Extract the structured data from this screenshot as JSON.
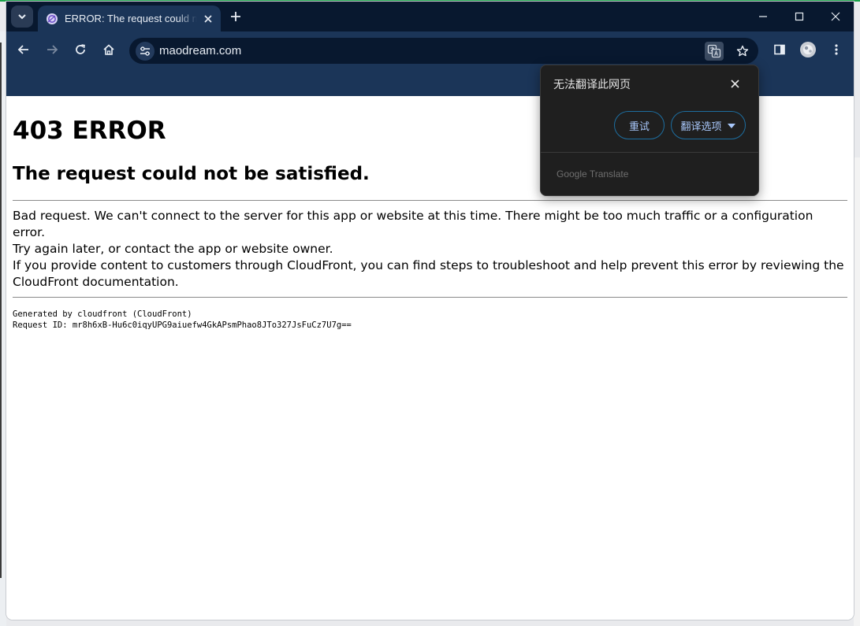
{
  "browser": {
    "tab": {
      "title": "ERROR: The request could not be satisfied"
    },
    "address": {
      "url": "maodream.com"
    }
  },
  "page": {
    "heading": "403 ERROR",
    "subheading": "The request could not be satisfied.",
    "body_lines": [
      "Bad request. We can't connect to the server for this app or website at this time. There might be too much traffic or a configuration error.",
      "Try again later, or contact the app or website owner.",
      "If you provide content to customers through CloudFront, you can find steps to troubleshoot and help prevent this error by reviewing the",
      "CloudFront documentation."
    ],
    "generated_by": "Generated by cloudfront (CloudFront)",
    "request_id": "Request ID: mr8h6xB-Hu6c0iqyUPG9aiuefw4GkAPsmPhao8JTo327JsFuCz7U7g=="
  },
  "translate_popup": {
    "title": "无法翻译此网页",
    "retry_label": "重试",
    "options_label": "翻译选项",
    "footer": "Google Translate"
  },
  "icons": {
    "tab_search": "chevron-down-icon",
    "favicon": "globe-icon",
    "tab_close": "close-icon",
    "new_tab": "plus-icon",
    "minimize": "minimize-icon",
    "maximize": "maximize-icon",
    "close_window": "close-icon",
    "back": "arrow-left-icon",
    "forward": "arrow-right-icon",
    "reload": "reload-icon",
    "home": "home-icon",
    "site_info": "tune-icon",
    "translate": "translate-icon",
    "bookmark": "star-icon",
    "side_panel": "side-panel-icon",
    "profile": "avatar-icon",
    "menu": "kebab-menu-icon"
  },
  "colors": {
    "frame": "#08182f",
    "toolbar": "#1b3558",
    "popup_bg": "#1f1f1f",
    "popup_button_text": "#a8c7fa",
    "popup_button_border": "#1d6ea0"
  }
}
